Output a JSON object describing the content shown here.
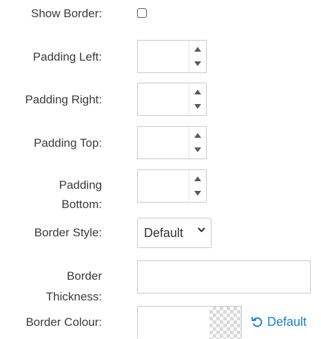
{
  "fields": {
    "show_border": {
      "label": "Show Border:",
      "checked": false
    },
    "padding_left": {
      "label": "Padding Left:",
      "value": ""
    },
    "padding_right": {
      "label": "Padding Right:",
      "value": ""
    },
    "padding_top": {
      "label": "Padding Top:",
      "value": ""
    },
    "padding_bottom": {
      "label_line1": "Padding",
      "label_line2": "Bottom:",
      "value": ""
    },
    "border_style": {
      "label": "Border Style:",
      "selected": "Default"
    },
    "border_thickness": {
      "label_line1": "Border",
      "label_line2": "Thickness:",
      "value": ""
    },
    "border_colour": {
      "label": "Border Colour:",
      "value": "",
      "reset_label": "Default"
    }
  },
  "icons": {
    "spinner_up": "triangle-up-icon",
    "spinner_down": "triangle-down-icon",
    "select_chevron": "chevron-down-icon",
    "reset": "undo-icon",
    "swatch": "transparent-checkerboard"
  },
  "colors": {
    "link": "#1a7fc9",
    "border": "#c8c8c8",
    "label": "#3a3a3a"
  }
}
